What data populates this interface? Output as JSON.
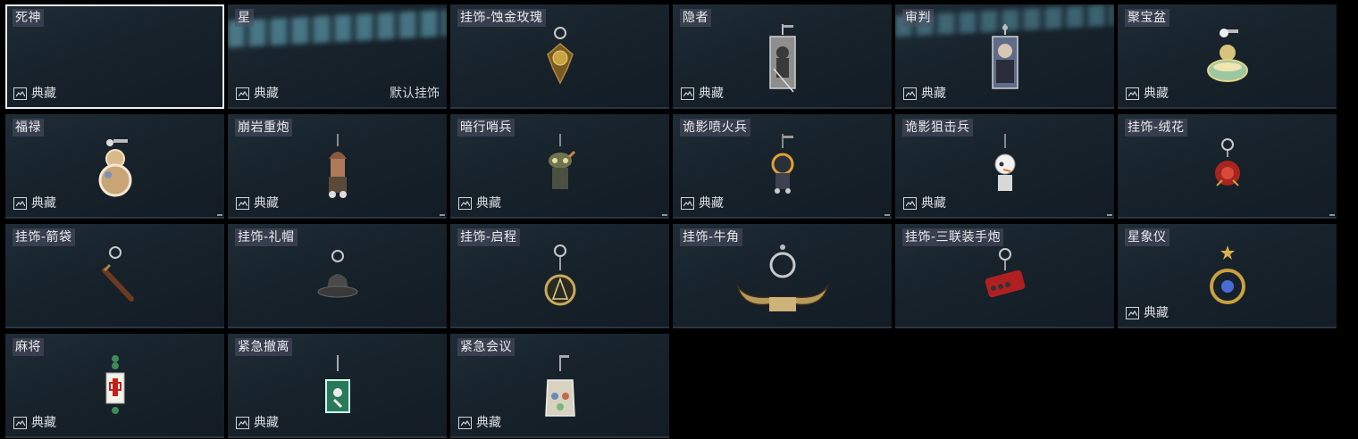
{
  "items": [
    {
      "name": "死神",
      "collection": "典藏",
      "default": "",
      "selected": true,
      "icon": "none"
    },
    {
      "name": "星",
      "collection": "典藏",
      "default": "默认挂饰",
      "selected": false,
      "icon": "none"
    },
    {
      "name": "挂饰-蚀金玫瑰",
      "collection": "",
      "default": "",
      "selected": false,
      "icon": "gold-rose-charm-icon"
    },
    {
      "name": "隐者",
      "collection": "典藏",
      "default": "",
      "selected": false,
      "icon": "hermit-card-charm-icon"
    },
    {
      "name": "审判",
      "collection": "典藏",
      "default": "",
      "selected": false,
      "icon": "judgement-card-charm-icon"
    },
    {
      "name": "聚宝盆",
      "collection": "典藏",
      "default": "",
      "selected": false,
      "icon": "treasure-bowl-charm-icon"
    },
    {
      "name": "福禄",
      "collection": "典藏",
      "default": "",
      "selected": false,
      "icon": "gourd-charm-icon"
    },
    {
      "name": "崩岩重炮",
      "collection": "典藏",
      "default": "",
      "selected": false,
      "icon": "heavy-cannon-figure-charm-icon"
    },
    {
      "name": "暗行哨兵",
      "collection": "典藏",
      "default": "",
      "selected": false,
      "icon": "sentinel-figure-charm-icon"
    },
    {
      "name": "诡影喷火兵",
      "collection": "典藏",
      "default": "",
      "selected": false,
      "icon": "flamethrower-figure-charm-icon"
    },
    {
      "name": "诡影狙击兵",
      "collection": "典藏",
      "default": "",
      "selected": false,
      "icon": "sniper-figure-charm-icon"
    },
    {
      "name": "挂饰-绒花",
      "collection": "",
      "default": "",
      "selected": false,
      "icon": "red-flower-charm-icon"
    },
    {
      "name": "挂饰-箭袋",
      "collection": "",
      "default": "",
      "selected": false,
      "icon": "quiver-charm-icon"
    },
    {
      "name": "挂饰-礼帽",
      "collection": "",
      "default": "",
      "selected": false,
      "icon": "top-hat-charm-icon"
    },
    {
      "name": "挂饰-启程",
      "collection": "",
      "default": "",
      "selected": false,
      "icon": "compass-medal-charm-icon"
    },
    {
      "name": "挂饰-牛角",
      "collection": "",
      "default": "",
      "selected": false,
      "icon": "bull-horns-charm-icon"
    },
    {
      "name": "挂饰-三联装手炮",
      "collection": "",
      "default": "",
      "selected": false,
      "icon": "triple-hand-cannon-charm-icon"
    },
    {
      "name": "星象仪",
      "collection": "典藏",
      "default": "",
      "selected": false,
      "icon": "astrolabe-charm-icon"
    },
    {
      "name": "麻将",
      "collection": "典藏",
      "default": "",
      "selected": false,
      "icon": "mahjong-tile-charm-icon"
    },
    {
      "name": "紧急撤离",
      "collection": "典藏",
      "default": "",
      "selected": false,
      "icon": "emergency-exit-charm-icon"
    },
    {
      "name": "紧急会议",
      "collection": "典藏",
      "default": "",
      "selected": false,
      "icon": "emergency-meeting-charm-icon"
    }
  ]
}
